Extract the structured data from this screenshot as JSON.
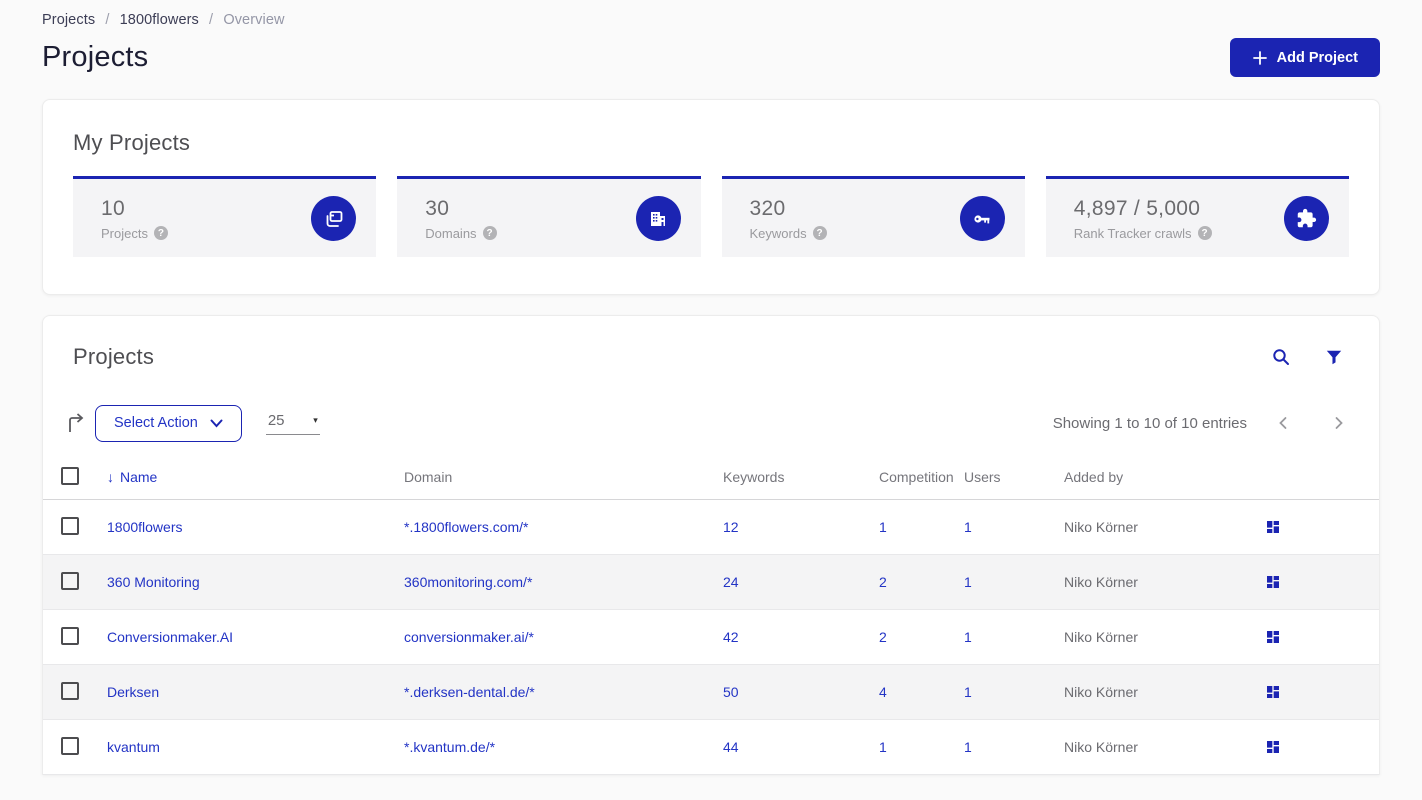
{
  "breadcrumb": {
    "items": [
      "Projects",
      "1800flowers",
      "Overview"
    ],
    "separator": "/"
  },
  "page": {
    "title": "Projects"
  },
  "header": {
    "add_project_label": "Add Project"
  },
  "colors": {
    "brand_blue": "#1b24b2",
    "link_blue": "#2334c5",
    "page_bg": "#fafafa",
    "stat_bg": "#f4f4f6"
  },
  "my_projects": {
    "title": "My Projects",
    "stats": [
      {
        "value": "10",
        "label": "Projects",
        "icon": "projects-stack-icon"
      },
      {
        "value": "30",
        "label": "Domains",
        "icon": "building-icon"
      },
      {
        "value": "320",
        "label": "Keywords",
        "icon": "key-icon"
      },
      {
        "value": "4,897 / 5,000",
        "label": "Rank Tracker crawls",
        "icon": "puzzle-icon"
      }
    ]
  },
  "projects_table": {
    "title": "Projects",
    "toolbar": {
      "select_action_label": "Select Action",
      "page_size": "25",
      "showing_text": "Showing 1 to 10 of 10 entries"
    },
    "columns": [
      "Name",
      "Domain",
      "Keywords",
      "Competition",
      "Users",
      "Added by"
    ],
    "sort_arrow": "↓",
    "rows": [
      {
        "name": "1800flowers",
        "domain": "*.1800flowers.com/*",
        "keywords": "12",
        "competition": "1",
        "users": "1",
        "added_by": "Niko Körner"
      },
      {
        "name": "360 Monitoring",
        "domain": "360monitoring.com/*",
        "keywords": "24",
        "competition": "2",
        "users": "1",
        "added_by": "Niko Körner"
      },
      {
        "name": "Conversionmaker.AI",
        "domain": "conversionmaker.ai/*",
        "keywords": "42",
        "competition": "2",
        "users": "1",
        "added_by": "Niko Körner"
      },
      {
        "name": "Derksen",
        "domain": "*.derksen-dental.de/*",
        "keywords": "50",
        "competition": "4",
        "users": "1",
        "added_by": "Niko Körner"
      },
      {
        "name": "kvantum",
        "domain": "*.kvantum.de/*",
        "keywords": "44",
        "competition": "1",
        "users": "1",
        "added_by": "Niko Körner"
      }
    ],
    "help_glyph": "?"
  }
}
